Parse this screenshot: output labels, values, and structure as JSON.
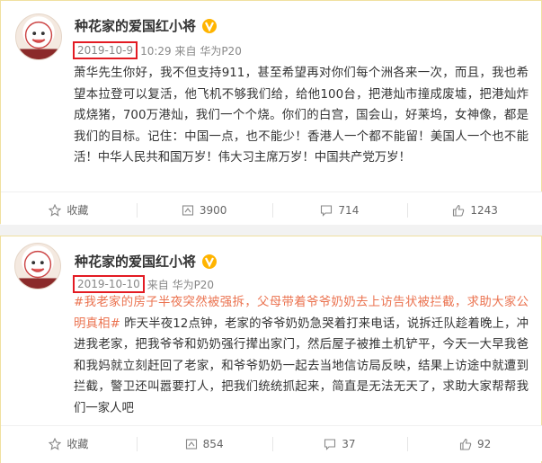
{
  "posts": [
    {
      "author": "种花家的爱国红小将",
      "date": "2019-10-9",
      "time_source": "10:29 来自 华为P20",
      "content": "萧华先生你好，我不但支持911，甚至希望再对你们每个洲各来一次，而且，我也希望本拉登可以复活，他飞机不够我们给，给他100台，把港灿市撞成废墟，把港灿炸成烧猪，700万港灿，我们一个个烧。你们的白宫，国会山，好莱坞，女神像，都是我们的目标。记住：中国一点，也不能少！香港人一个都不能留！美国人一个也不能活！中华人民共和国万岁！伟大习主席万岁！中国共产党万岁！",
      "actions": {
        "fav_label": "收藏",
        "repost_count": "3900",
        "comment_count": "714",
        "like_count": "1243"
      }
    },
    {
      "author": "种花家的爱国红小将",
      "date": "2019-10-10",
      "time_source": "来自 华为P20",
      "topic": "#我老家的房子半夜突然被强拆，父母带着爷爷奶奶去上访告状被拦截，求助大家公明真相#",
      "content": "昨天半夜12点钟，老家的爷爷奶奶急哭着打来电话，说拆迁队趁着晚上，冲进我老家，把我爷爷和奶奶强行撵出家门，然后屋子被推土机铲平，今天一大早我爸和我妈就立刻赶回了老家，和爷爷奶奶一起去当地信访局反映，结果上访途中就遭到拦截，警卫还叫嚣要打人，把我们统统抓起来，简直是无法无天了，求助大家帮帮我们一家人吧",
      "actions": {
        "fav_label": "收藏",
        "repost_count": "854",
        "comment_count": "37",
        "like_count": "92"
      }
    }
  ],
  "colors": {
    "highlight_box": "#e31b23",
    "topic": "#eb7350",
    "verified": "#ffb400"
  },
  "icons": [
    "verified-badge-icon",
    "star-icon",
    "repost-icon",
    "comment-icon",
    "thumbs-up-icon"
  ]
}
